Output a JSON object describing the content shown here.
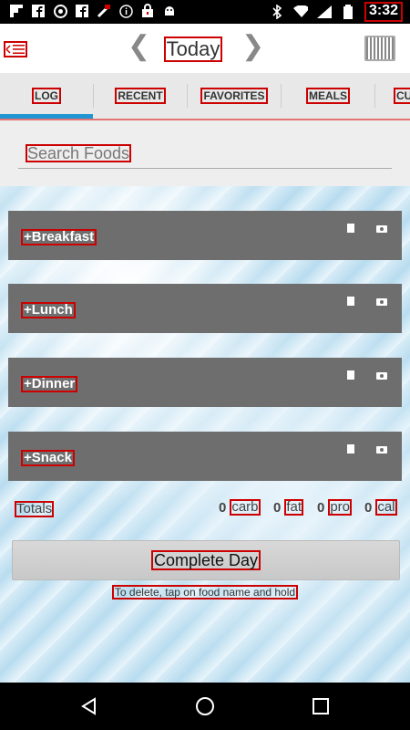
{
  "status_bar": {
    "time": "3:32",
    "left_icons": [
      "flipboard-icon",
      "facebook-icon",
      "camera-aperture-icon",
      "facebook-icon",
      "feed-icon",
      "info-icon",
      "lock-icon",
      "android-icon"
    ],
    "right_icons": [
      "bluetooth-icon",
      "wifi-icon",
      "signal-icon",
      "battery-icon"
    ]
  },
  "header": {
    "title": "Today",
    "prev_glyph": "❮",
    "next_glyph": "❯",
    "back_icon": "menu-back-icon",
    "barcode_icon": "barcode-icon"
  },
  "tabs": [
    {
      "label": "LOG"
    },
    {
      "label": "RECENT"
    },
    {
      "label": "FAVORITES"
    },
    {
      "label": "MEALS"
    },
    {
      "label": "CU"
    }
  ],
  "search": {
    "placeholder": "Search Foods"
  },
  "meals": [
    {
      "label": "+Breakfast"
    },
    {
      "label": "+Lunch"
    },
    {
      "label": "+Dinner"
    },
    {
      "label": "+Snack"
    }
  ],
  "totals": {
    "label": "Totals",
    "carb": {
      "value": "0",
      "unit": "carb"
    },
    "fat": {
      "value": "0",
      "unit": "fat"
    },
    "pro": {
      "value": "0",
      "unit": "pro"
    },
    "cal": {
      "value": "0",
      "unit": "cal"
    }
  },
  "actions": {
    "complete_day": "Complete Day",
    "hint": "To delete, tap on food name and hold"
  },
  "colors": {
    "tab_indicator": "#2196d3",
    "meal_bar": "#6e6e6e",
    "highlight_box": "#cc0000"
  }
}
